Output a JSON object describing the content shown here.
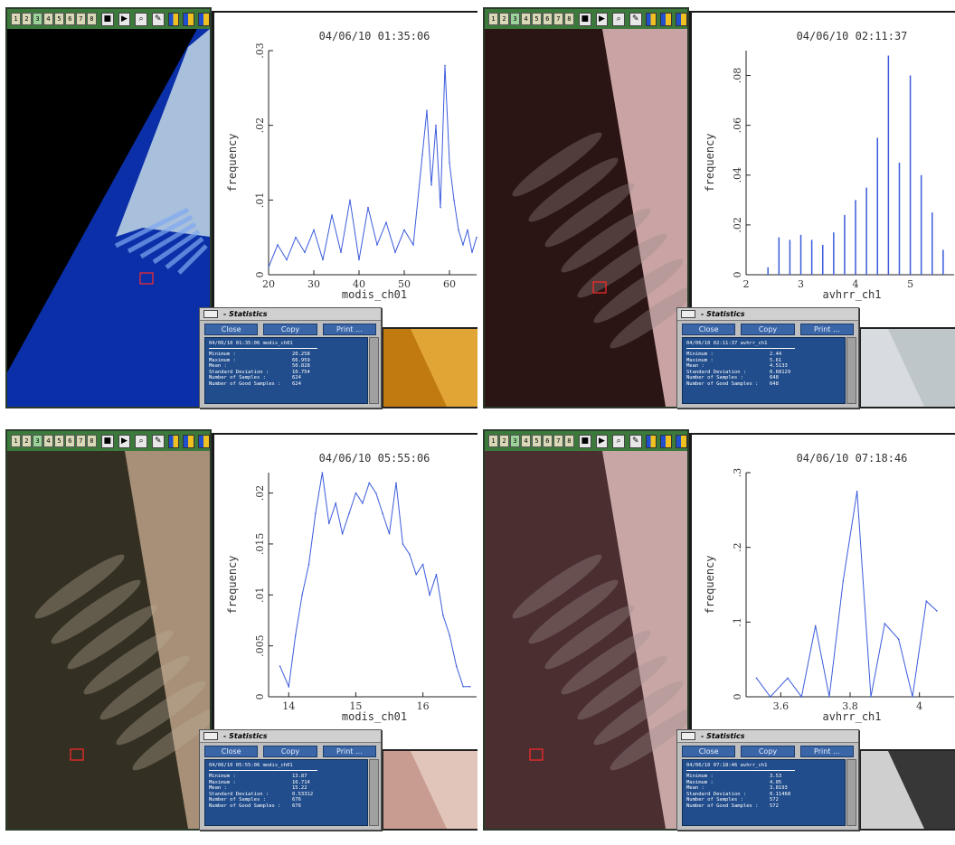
{
  "toolbar": {
    "frame_buttons": [
      "1",
      "2",
      "3",
      "4",
      "5",
      "6",
      "7",
      "8"
    ],
    "control_icons": [
      "stop-icon",
      "play-icon",
      "zoom-icon",
      "tool-icon",
      "flag-icon",
      "flag-icon",
      "flag-icon"
    ]
  },
  "panels": [
    {
      "timestamp": "04/06/10 01:35:06",
      "xlabel": "modis_ch01",
      "ylabel": "frequency",
      "xticks": [
        "20",
        "30",
        "40",
        "50",
        "60"
      ],
      "yticks": [
        "0",
        ".01",
        ".02",
        ".03"
      ],
      "stats": {
        "title": "- Statistics",
        "buttons": [
          "Close",
          "Copy",
          "Print ..."
        ],
        "header": "04/06/10 01:35:06  modis_ch01",
        "rows": [
          {
            "k": "Minimum :",
            "v": "20.258"
          },
          {
            "k": "Maximum :",
            "v": "66.959"
          },
          {
            "k": "Mean :",
            "v": "50.828"
          },
          {
            "k": "Standard Deviation :",
            "v": "10.754"
          },
          {
            "k": "Number of Samples :",
            "v": "624"
          },
          {
            "k": "Number of Good Samples :",
            "v": "624"
          }
        ]
      },
      "colors": {
        "line": "#3b5bdc"
      }
    },
    {
      "timestamp": "04/06/10 02:11:37",
      "xlabel": "avhrr_ch1",
      "ylabel": "frequency",
      "xticks": [
        "2",
        "3",
        "4",
        "5"
      ],
      "yticks": [
        "0",
        ".02",
        ".04",
        ".06",
        ".08"
      ],
      "stats": {
        "title": "- Statistics",
        "buttons": [
          "Close",
          "Copy",
          "Print ..."
        ],
        "header": "04/06/10 02:11:37  avhrr_ch1",
        "rows": [
          {
            "k": "Minimum :",
            "v": "2.44"
          },
          {
            "k": "Maximum :",
            "v": "5.61"
          },
          {
            "k": "Mean :",
            "v": "4.5133"
          },
          {
            "k": "Standard Deviation :",
            "v": "0.68129"
          },
          {
            "k": "Number of Samples :",
            "v": "648"
          },
          {
            "k": "Number of Good Samples :",
            "v": "648"
          }
        ]
      },
      "colors": {
        "line": "#3b5bdc"
      }
    },
    {
      "timestamp": "04/06/10 05:55:06",
      "xlabel": "modis_ch01",
      "ylabel": "frequency",
      "xticks": [
        "14",
        "15",
        "16"
      ],
      "yticks": [
        "0",
        ".005",
        ".01",
        ".015",
        ".02"
      ],
      "stats": {
        "title": "- Statistics",
        "buttons": [
          "Close",
          "Copy",
          "Print ..."
        ],
        "header": "04/06/10 05:55:06  modis_ch01",
        "rows": [
          {
            "k": "Minimum :",
            "v": "13.87"
          },
          {
            "k": "Maximum :",
            "v": "16.714"
          },
          {
            "k": "Mean :",
            "v": "15.22"
          },
          {
            "k": "Standard Deviation :",
            "v": "0.53312"
          },
          {
            "k": "Number of Samples :",
            "v": "676"
          },
          {
            "k": "Number of Good Samples :",
            "v": "676"
          }
        ]
      },
      "colors": {
        "line": "#3b5bdc"
      }
    },
    {
      "timestamp": "04/06/10 07:18:46",
      "xlabel": "avhrr_ch1",
      "ylabel": "frequency",
      "xticks": [
        "3.6",
        "3.8",
        "4"
      ],
      "yticks": [
        "0",
        ".1",
        ".2",
        ".3"
      ],
      "stats": {
        "title": "- Statistics",
        "buttons": [
          "Close",
          "Copy",
          "Print ..."
        ],
        "header": "04/06/10 07:18:46  avhrr_ch1",
        "rows": [
          {
            "k": "Minimum :",
            "v": "3.53"
          },
          {
            "k": "Maximum :",
            "v": "4.05"
          },
          {
            "k": "Mean :",
            "v": "3.8193"
          },
          {
            "k": "Standard Deviation :",
            "v": "0.11468"
          },
          {
            "k": "Number of Samples :",
            "v": "572"
          },
          {
            "k": "Number of Good Samples :",
            "v": "572"
          }
        ]
      },
      "colors": {
        "line": "#3b5bdc"
      }
    }
  ],
  "chart_data": [
    {
      "type": "line",
      "xlabel": "modis_ch01",
      "ylabel": "frequency",
      "xlim": [
        20,
        66
      ],
      "ylim": [
        0,
        0.03
      ],
      "x": [
        20,
        22,
        24,
        26,
        28,
        30,
        32,
        34,
        36,
        38,
        40,
        42,
        44,
        46,
        48,
        50,
        52,
        54,
        55,
        56,
        57,
        58,
        59,
        60,
        61,
        62,
        63,
        64,
        65,
        66
      ],
      "values": [
        0.001,
        0.004,
        0.002,
        0.005,
        0.003,
        0.006,
        0.002,
        0.008,
        0.003,
        0.01,
        0.002,
        0.009,
        0.004,
        0.007,
        0.003,
        0.006,
        0.004,
        0.016,
        0.022,
        0.012,
        0.02,
        0.009,
        0.028,
        0.015,
        0.01,
        0.006,
        0.004,
        0.006,
        0.003,
        0.005
      ]
    },
    {
      "type": "bar",
      "xlabel": "avhrr_ch1",
      "ylabel": "frequency",
      "xlim": [
        2,
        5.8
      ],
      "ylim": [
        0,
        0.09
      ],
      "x": [
        2.4,
        2.6,
        2.8,
        3.0,
        3.2,
        3.4,
        3.6,
        3.8,
        4.0,
        4.2,
        4.4,
        4.6,
        4.8,
        5.0,
        5.2,
        5.4,
        5.6
      ],
      "values": [
        0.003,
        0.015,
        0.014,
        0.016,
        0.014,
        0.012,
        0.017,
        0.024,
        0.03,
        0.035,
        0.055,
        0.088,
        0.045,
        0.08,
        0.04,
        0.025,
        0.01
      ]
    },
    {
      "type": "line",
      "xlabel": "modis_ch01",
      "ylabel": "frequency",
      "xlim": [
        13.7,
        16.8
      ],
      "ylim": [
        0,
        0.022
      ],
      "x": [
        13.87,
        14.0,
        14.1,
        14.2,
        14.3,
        14.4,
        14.5,
        14.6,
        14.7,
        14.8,
        14.9,
        15.0,
        15.1,
        15.2,
        15.3,
        15.4,
        15.5,
        15.6,
        15.7,
        15.8,
        15.9,
        16.0,
        16.1,
        16.2,
        16.3,
        16.4,
        16.5,
        16.6,
        16.7
      ],
      "values": [
        0.003,
        0.001,
        0.006,
        0.01,
        0.013,
        0.018,
        0.022,
        0.017,
        0.019,
        0.016,
        0.018,
        0.02,
        0.019,
        0.021,
        0.02,
        0.018,
        0.016,
        0.021,
        0.015,
        0.014,
        0.012,
        0.013,
        0.01,
        0.012,
        0.008,
        0.006,
        0.003,
        0.001,
        0.001
      ]
    },
    {
      "type": "line",
      "xlabel": "avhrr_ch1",
      "ylabel": "frequency",
      "xlim": [
        3.5,
        4.1
      ],
      "ylim": [
        0,
        0.3
      ],
      "x": [
        3.53,
        3.57,
        3.62,
        3.66,
        3.7,
        3.74,
        3.78,
        3.82,
        3.86,
        3.9,
        3.94,
        3.98,
        4.02,
        4.05
      ],
      "values": [
        0.025,
        0.0,
        0.025,
        0.0,
        0.095,
        0.0,
        0.155,
        0.275,
        0.0,
        0.098,
        0.077,
        0.0,
        0.128,
        0.115
      ]
    }
  ]
}
